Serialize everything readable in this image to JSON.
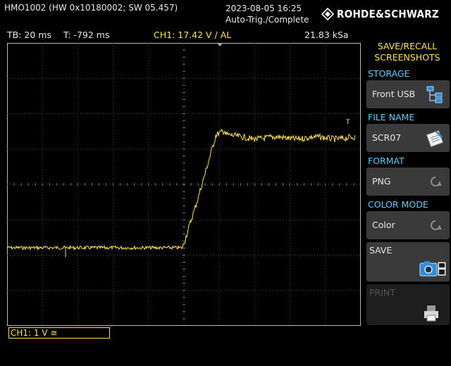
{
  "header": {
    "device": "HMO1002 (HW 0x10180002; SW 05.457)",
    "datetime": "2023-08-05 16:25",
    "trigger_status": "Auto-Trig./Complete",
    "brand": "ROHDE&SCHWARZ"
  },
  "status": {
    "timebase": "TB: 20 ms",
    "trigger_time": "T: -792 ms",
    "trigger_info": "CH1: 17.42 V ∕ AL",
    "sample_rate": "21.83 kSa"
  },
  "menu": {
    "title_line1": "SAVE/RECALL",
    "title_line2": "SCREENSHOTS",
    "storage": {
      "label": "STORAGE",
      "value": "Front USB",
      "icon": "usb-storage-icon"
    },
    "file_name": {
      "label": "FILE NAME",
      "value": "SCR07",
      "icon": "edit-note-icon"
    },
    "format": {
      "label": "FORMAT",
      "value": "PNG",
      "icon": "cycle-arrow-icon"
    },
    "color_mode": {
      "label": "COLOR MODE",
      "value": "Color",
      "icon": "cycle-arrow-icon"
    },
    "save": {
      "label": "SAVE",
      "icon": "camera-save-icon"
    },
    "print": {
      "label": "PRINT",
      "icon": "printer-icon"
    }
  },
  "channel": {
    "label": "CH1: 1 V ≅",
    "marker": "1",
    "trigger_marker": "T",
    "color": "#ffe34d"
  },
  "colors": {
    "accent": "#ffe34d",
    "menu_label": "#5ecfff",
    "grid": "#5a5a5a"
  }
}
